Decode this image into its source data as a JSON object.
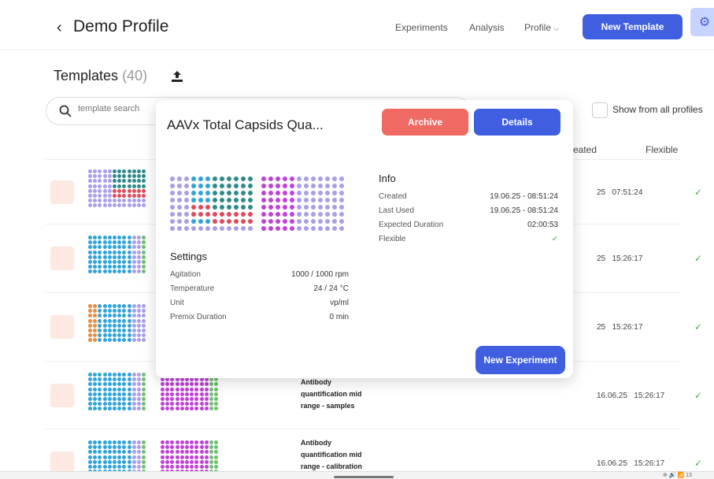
{
  "header": {
    "back_icon": "chevron-left",
    "title": "Demo Profile",
    "nav": {
      "experiments": "Experiments",
      "analysis": "Analysis",
      "profile": "Profile"
    },
    "new_template": "New Template",
    "settings_icon": "gear-icon"
  },
  "templates": {
    "title": "Templates",
    "count": "(40)",
    "upload_icon": "upload-icon",
    "search_placeholder": "template search",
    "show_all_label": "Show from all profiles",
    "columns": {
      "created": "reated",
      "flexible": "Flexible"
    }
  },
  "rows": [
    {
      "name": "",
      "date": "25",
      "time": "07:51:24",
      "flexible": "✓"
    },
    {
      "name": "",
      "date": "25",
      "time": "15:26:17",
      "flexible": "✓"
    },
    {
      "name": "",
      "date": "25",
      "time": "15:26:17",
      "flexible": "✓"
    },
    {
      "name_line1": "Antibody",
      "name_line2": "quantification mid",
      "name_line3": "range - samples",
      "date": "16.06.25",
      "time": "15:26:17",
      "flexible": "✓"
    },
    {
      "name_line1": "Antibody",
      "name_line2": "quantification mid",
      "name_line3": "range - calibration",
      "date": "16.06.25",
      "time": "15:26:17",
      "flexible": "✓"
    }
  ],
  "modal": {
    "title": "AAVx Total Capsids Qua...",
    "archive": "Archive",
    "details": "Details",
    "settings": {
      "title": "Settings",
      "items": [
        {
          "label": "Agitation",
          "value": "1000 / 1000 rpm"
        },
        {
          "label": "Temperature",
          "value": "24 / 24 °C"
        },
        {
          "label": "Unit",
          "value": "vp/ml"
        },
        {
          "label": "Premix Duration",
          "value": "0 min"
        }
      ]
    },
    "info": {
      "title": "Info",
      "items": [
        {
          "label": "Created",
          "value": "19.06.25 - 08:51:24"
        },
        {
          "label": "Last Used",
          "value": "19.06.25 - 08:51:24"
        },
        {
          "label": "Expected Duration",
          "value": "02:00:53"
        },
        {
          "label": "Flexible",
          "value": "✓"
        }
      ]
    },
    "new_experiment": "New Experiment"
  },
  "colors": {
    "primary": "#3f5ee0",
    "archive": "#f06a63",
    "check": "#4cae4c",
    "well_purple": "#a99ee8",
    "well_teal": "#2f8a8a",
    "well_blue": "#2fa4d8",
    "well_magenta": "#c040d8",
    "well_red": "#e04a5a",
    "well_orange": "#ee8a3a",
    "well_green": "#6cc06c"
  },
  "taskbar": {
    "tray": "⊕ 🔊 📶 13"
  }
}
